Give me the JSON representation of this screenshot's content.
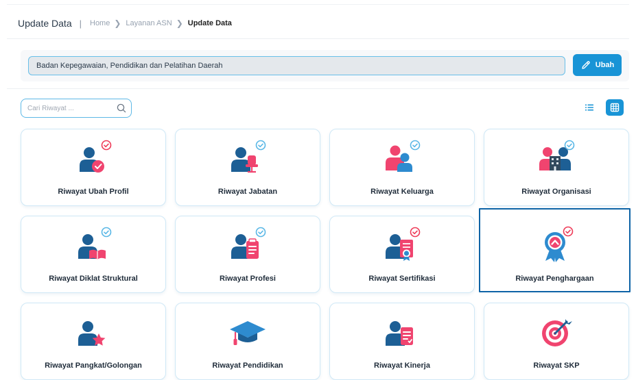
{
  "header": {
    "title": "Update Data",
    "separator": "|",
    "breadcrumb": [
      {
        "label": "Home"
      },
      {
        "label": "Layanan ASN"
      },
      {
        "label": "Update Data"
      }
    ]
  },
  "unit": {
    "value": "Badan Kepegawaian, Pendidikan dan Pelatihan Daerah",
    "edit_label": "Ubah"
  },
  "search": {
    "placeholder": "Cari Riwayat ..."
  },
  "view": {
    "active": "grid",
    "modes": [
      "list",
      "grid"
    ]
  },
  "colors": {
    "primary": "#1994d6",
    "person_dark": "#1d5f95",
    "person_light": "#2e8bcf",
    "accent": "#f0446f",
    "badge_blue": "#59b7e6",
    "badge_red": "#ee3a57",
    "selected_border": "#0d63a6"
  },
  "cards": [
    {
      "label": "Riwayat Ubah Profil",
      "icon": "person-check-icon",
      "badge": "red"
    },
    {
      "label": "Riwayat Jabatan",
      "icon": "person-chair-icon",
      "badge": "blue"
    },
    {
      "label": "Riwayat Keluarga",
      "icon": "family-icon",
      "badge": "blue"
    },
    {
      "label": "Riwayat Organisasi",
      "icon": "person-building-icon",
      "badge": "blue"
    },
    {
      "label": "Riwayat Diklat Struktural",
      "icon": "person-book-icon",
      "badge": "blue"
    },
    {
      "label": "Riwayat Profesi",
      "icon": "person-clipboard-icon",
      "badge": "blue"
    },
    {
      "label": "Riwayat Sertifikasi",
      "icon": "person-certificate-icon",
      "badge": "red"
    },
    {
      "label": "Riwayat Penghargaan",
      "icon": "award-medal-icon",
      "badge": "red",
      "selected": true
    },
    {
      "label": "Riwayat Pangkat/Golongan",
      "icon": "person-star-icon",
      "badge": "none"
    },
    {
      "label": "Riwayat Pendidikan",
      "icon": "graduation-cap-icon",
      "badge": "none"
    },
    {
      "label": "Riwayat Kinerja",
      "icon": "person-report-icon",
      "badge": "none"
    },
    {
      "label": "Riwayat SKP",
      "icon": "target-icon",
      "badge": "none"
    }
  ]
}
